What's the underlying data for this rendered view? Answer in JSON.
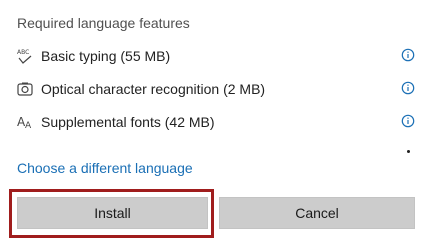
{
  "section": {
    "title": "Required language features"
  },
  "features": [
    {
      "icon": "abc-typing-icon",
      "label": "Basic typing (55 MB)"
    },
    {
      "icon": "ocr-camera-icon",
      "label": "Optical character recognition (2 MB)"
    },
    {
      "icon": "fonts-icon",
      "label": "Supplemental fonts (42 MB)"
    }
  ],
  "link": {
    "label": "Choose a different language"
  },
  "buttons": {
    "install": "Install",
    "cancel": "Cancel"
  },
  "colors": {
    "link": "#1a6fb5",
    "info_icon": "#1a6fb5",
    "button_bg": "#cccccc",
    "highlight": "#a01d1d"
  }
}
